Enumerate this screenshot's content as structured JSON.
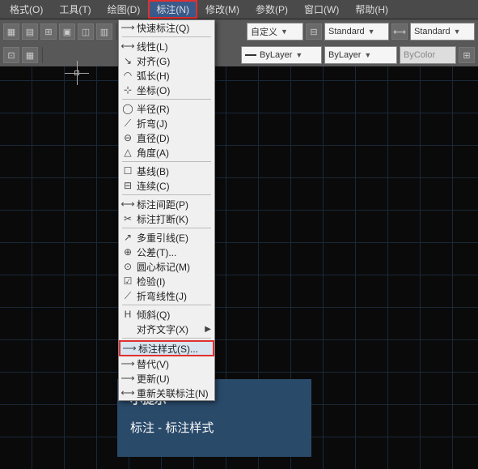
{
  "menubar": {
    "items": [
      {
        "label": "格式(O)"
      },
      {
        "label": "工具(T)"
      },
      {
        "label": "绘图(D)"
      },
      {
        "label": "标注(N)",
        "hl": true
      },
      {
        "label": "修改(M)"
      },
      {
        "label": "参数(P)"
      },
      {
        "label": "窗口(W)"
      },
      {
        "label": "帮助(H)"
      }
    ]
  },
  "toolbar1": {
    "combo_custom": "自定义",
    "combo_std1": "Standard",
    "combo_std2": "Standard"
  },
  "toolbar2": {
    "bylayer1": "ByLayer",
    "bylayer2": "ByLayer",
    "bycolor": "ByColor"
  },
  "dropdown": {
    "items": [
      {
        "icon": "⟶",
        "label": "快速标注(Q)"
      },
      {
        "sep": true
      },
      {
        "icon": "⟷",
        "label": "线性(L)"
      },
      {
        "icon": "↘",
        "label": "对齐(G)"
      },
      {
        "icon": "◠",
        "label": "弧长(H)"
      },
      {
        "icon": "⊹",
        "label": "坐标(O)"
      },
      {
        "sep": true
      },
      {
        "icon": "◯",
        "label": "半径(R)"
      },
      {
        "icon": "⟋",
        "label": "折弯(J)"
      },
      {
        "icon": "⊖",
        "label": "直径(D)"
      },
      {
        "icon": "△",
        "label": "角度(A)"
      },
      {
        "sep": true
      },
      {
        "icon": "☐",
        "label": "基线(B)"
      },
      {
        "icon": "⊟",
        "label": "连续(C)"
      },
      {
        "sep": true
      },
      {
        "icon": "⟷",
        "label": "标注间距(P)"
      },
      {
        "icon": "✂",
        "label": "标注打断(K)"
      },
      {
        "sep": true
      },
      {
        "icon": "↗",
        "label": "多重引线(E)"
      },
      {
        "icon": "⊕",
        "label": "公差(T)..."
      },
      {
        "icon": "⊙",
        "label": "圆心标记(M)"
      },
      {
        "icon": "☑",
        "label": "检验(I)"
      },
      {
        "icon": "⟋",
        "label": "折弯线性(J)"
      },
      {
        "sep": true
      },
      {
        "icon": "H",
        "label": "倾斜(Q)"
      },
      {
        "icon": "",
        "label": "对齐文字(X)",
        "sub": true
      },
      {
        "sep": true
      },
      {
        "icon": "⟶",
        "label": "标注样式(S)...",
        "hl": true
      },
      {
        "icon": "⟶",
        "label": "替代(V)"
      },
      {
        "icon": "⟶",
        "label": "更新(U)"
      },
      {
        "icon": "⟷",
        "label": "重新关联标注(N)"
      }
    ]
  },
  "tip": {
    "title": "小提示",
    "body": "标注 - 标注样式"
  }
}
